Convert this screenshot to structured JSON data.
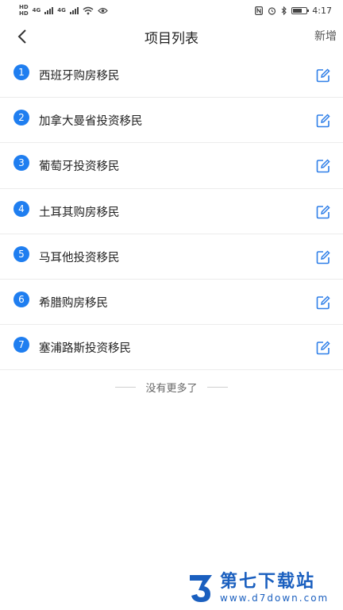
{
  "status_bar": {
    "net_label_1": "HD",
    "net_label_2": "4G",
    "net_label_3": "HD",
    "net_label_4": "4G",
    "time": "4:17"
  },
  "header": {
    "title": "项目列表",
    "add_label": "新增"
  },
  "projects": [
    {
      "index": "1",
      "name": "西班牙购房移民"
    },
    {
      "index": "2",
      "name": "加拿大曼省投资移民"
    },
    {
      "index": "3",
      "name": "葡萄牙投资移民"
    },
    {
      "index": "4",
      "name": "土耳其购房移民"
    },
    {
      "index": "5",
      "name": "马耳他投资移民"
    },
    {
      "index": "6",
      "name": "希腊购房移民"
    },
    {
      "index": "7",
      "name": "塞浦路斯投资移民"
    }
  ],
  "footer": {
    "no_more_text": "没有更多了"
  },
  "watermark": {
    "title": "第七下载站",
    "url": "www.d7down.com"
  },
  "colors": {
    "accent": "#1f7ef0",
    "edit_icon": "#2f7fe8",
    "watermark": "#1a5fbf"
  },
  "icons": {
    "back": "chevron-left-icon",
    "edit": "edit-pencil-icon"
  }
}
